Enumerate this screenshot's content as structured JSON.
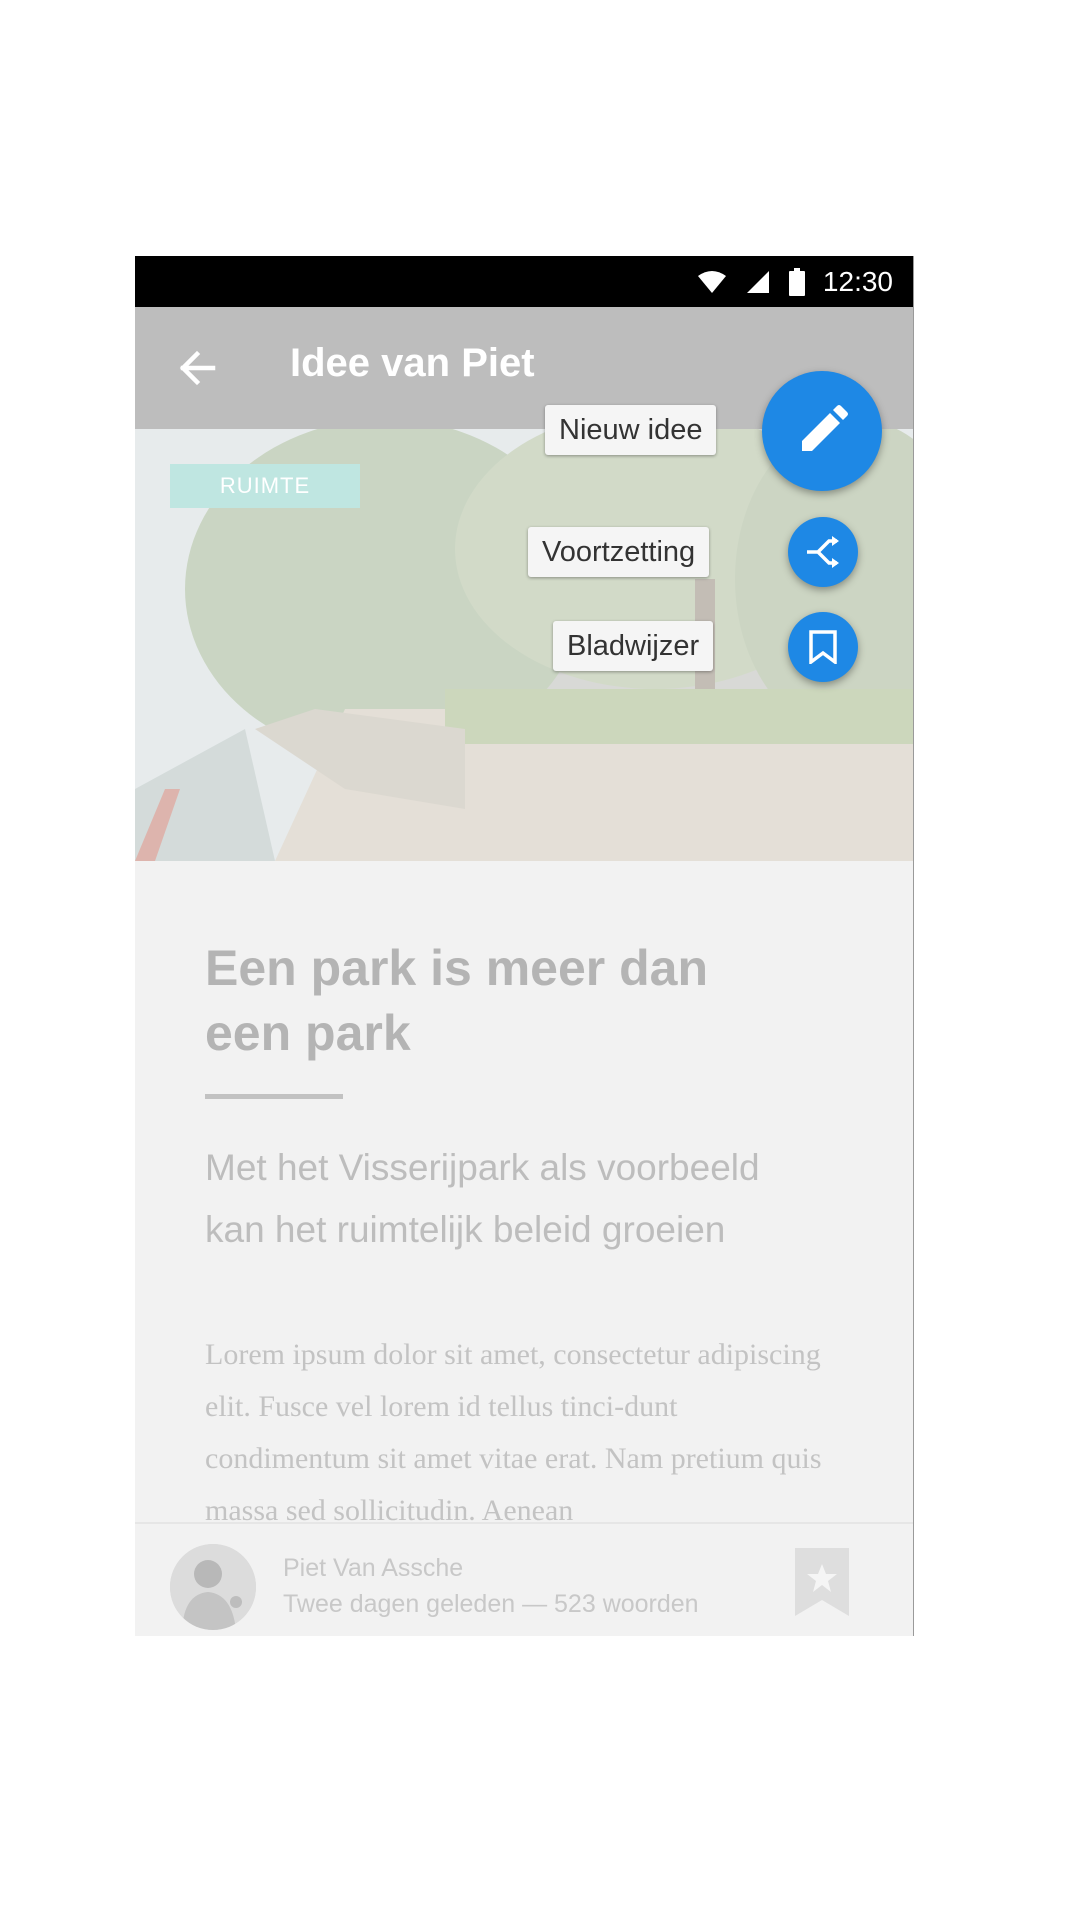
{
  "status_bar": {
    "time": "12:30",
    "icons": [
      "wifi-icon",
      "signal-icon",
      "battery-icon"
    ]
  },
  "app_bar": {
    "title": "Idee van Piet",
    "back_icon": "arrow-back-icon"
  },
  "hero": {
    "tag": "RUIMTE"
  },
  "article": {
    "headline": "Een park is meer dan een park",
    "subtitle": "Met het Visserijpark als voorbeeld kan het ruimtelijk beleid groeien",
    "body": "Lorem ipsum dolor sit amet, consectetur adipiscing elit. Fusce vel lorem id tellus tinci-dunt condimentum sit amet vitae erat. Nam pretium quis massa sed sollicitudin. Aenean"
  },
  "footer": {
    "author": "Piet Van Assche",
    "meta": "Twee dagen geleden — 523 woorden",
    "bookmark_icon": "star-bookmark-icon"
  },
  "speed_dial": {
    "main": {
      "label": "Nieuw idee",
      "icon": "pencil-icon"
    },
    "actions": [
      {
        "label": "Voortzetting",
        "icon": "shuffle-icon"
      },
      {
        "label": "Bladwijzer",
        "icon": "bookmark-icon"
      }
    ]
  },
  "colors": {
    "fab": "#1e88e5",
    "tag": "#bfe6e1",
    "app_bar": "#bdbdbd"
  }
}
